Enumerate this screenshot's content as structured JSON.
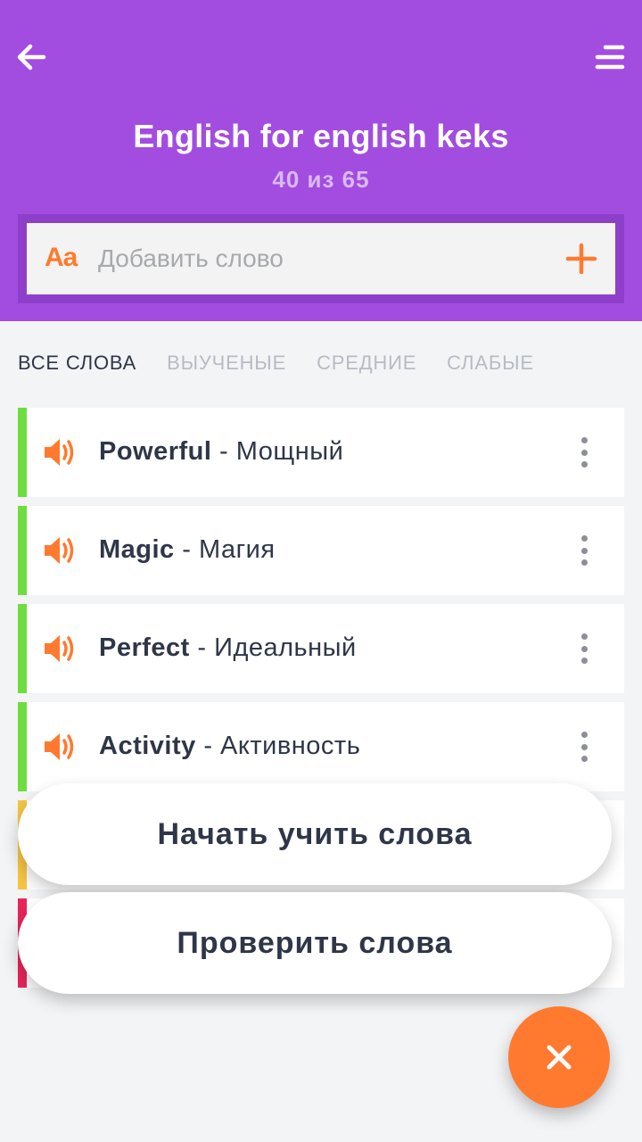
{
  "header": {
    "title": "English for english keks",
    "progress": "40 из 65",
    "background": "#a24de0"
  },
  "search": {
    "icon_label": "Aa",
    "placeholder": "Добавить слово"
  },
  "tabs": [
    {
      "label": "ВСЕ СЛОВА",
      "active": true
    },
    {
      "label": "ВЫУЧЕНЫЕ",
      "active": false
    },
    {
      "label": "СРЕДНИЕ",
      "active": false
    },
    {
      "label": "СЛАБЫЕ",
      "active": false
    }
  ],
  "words": [
    {
      "word": "Powerful",
      "separator": " - ",
      "translation": "Мощный",
      "status_color": "#6fdc3f"
    },
    {
      "word": "Magic",
      "separator": " - ",
      "translation": "Магия",
      "status_color": "#6fdc3f"
    },
    {
      "word": "Perfect",
      "separator": " - ",
      "translation": "Идеальный",
      "status_color": "#6fdc3f"
    },
    {
      "word": "Activity",
      "separator": " - ",
      "translation": "Активность",
      "status_color": "#6fdc3f"
    },
    {
      "word": "",
      "separator": "",
      "translation": "",
      "status_color": "#f7c544"
    },
    {
      "word": "",
      "separator": "",
      "translation": "",
      "status_color": "#e8255a"
    }
  ],
  "actions": {
    "learn": "Начать учить слова",
    "check": "Проверить слова"
  },
  "colors": {
    "accent": "#ff7a2f",
    "text": "#2f3648"
  }
}
